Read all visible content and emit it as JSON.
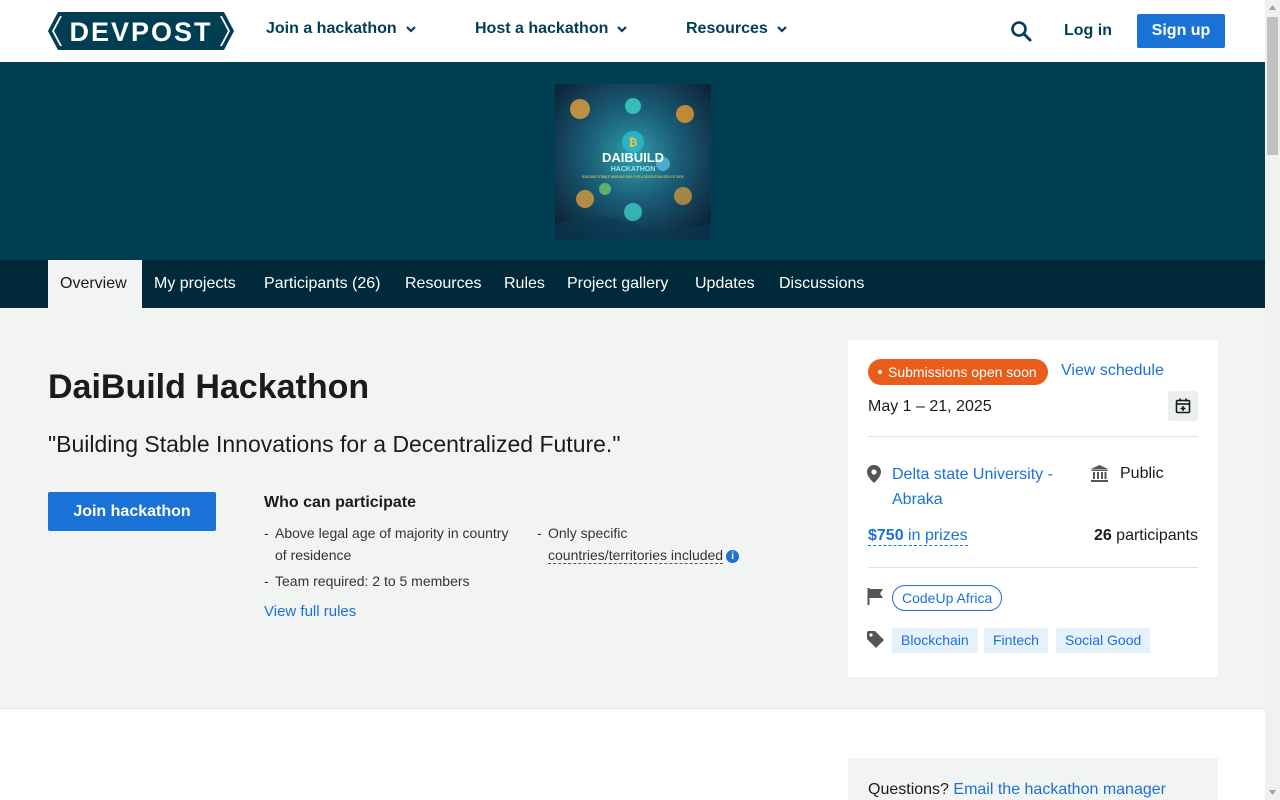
{
  "header": {
    "logo_text": "DEVPOST",
    "nav": [
      {
        "label": "Join a hackathon"
      },
      {
        "label": "Host a hackathon"
      },
      {
        "label": "Resources"
      }
    ],
    "login_label": "Log in",
    "signup_label": "Sign up"
  },
  "banner": {
    "image_title": "DAIBUILD",
    "image_subtitle": "HACKATHON",
    "image_caption": "BUILDING STABLE INNOVATIONS FOR A DECENTRALIZED FUTURE"
  },
  "tabs": [
    {
      "label": "Overview",
      "active": true
    },
    {
      "label": "My projects"
    },
    {
      "label": "Participants (26)"
    },
    {
      "label": "Resources"
    },
    {
      "label": "Rules"
    },
    {
      "label": "Project gallery"
    },
    {
      "label": "Updates"
    },
    {
      "label": "Discussions"
    }
  ],
  "hackathon": {
    "title": "DaiBuild Hackathon",
    "tagline": "\"Building Stable Innovations for a Decentralized Future.\"",
    "join_label": "Join hackathon",
    "who_title": "Who can participate",
    "eligibility_left": [
      "Above legal age of majority in country of residence",
      "Team required: 2 to 5 members"
    ],
    "eligibility_right_prefix": "Only specific",
    "eligibility_right_link": "countries/territories included",
    "view_rules_label": "View full rules"
  },
  "sidebar": {
    "status_badge": "Submissions open soon",
    "view_schedule": "View schedule",
    "dates": "May 1 – 21, 2025",
    "location": "Delta state University - Abraka",
    "visibility": "Public",
    "prizes_amount": "$750",
    "prizes_suffix": " in prizes",
    "participants_count": "26",
    "participants_suffix": " participants",
    "organizer": "CodeUp Africa",
    "tags": [
      "Blockchain",
      "Fintech",
      "Social Good"
    ]
  },
  "questions": {
    "prefix": "Questions? ",
    "link": "Email the hackathon manager"
  },
  "colors": {
    "brand_dark": "#003e54",
    "tabs_bg": "#00293a",
    "primary_blue": "#1a72d6",
    "status_orange": "#e85d1b"
  }
}
